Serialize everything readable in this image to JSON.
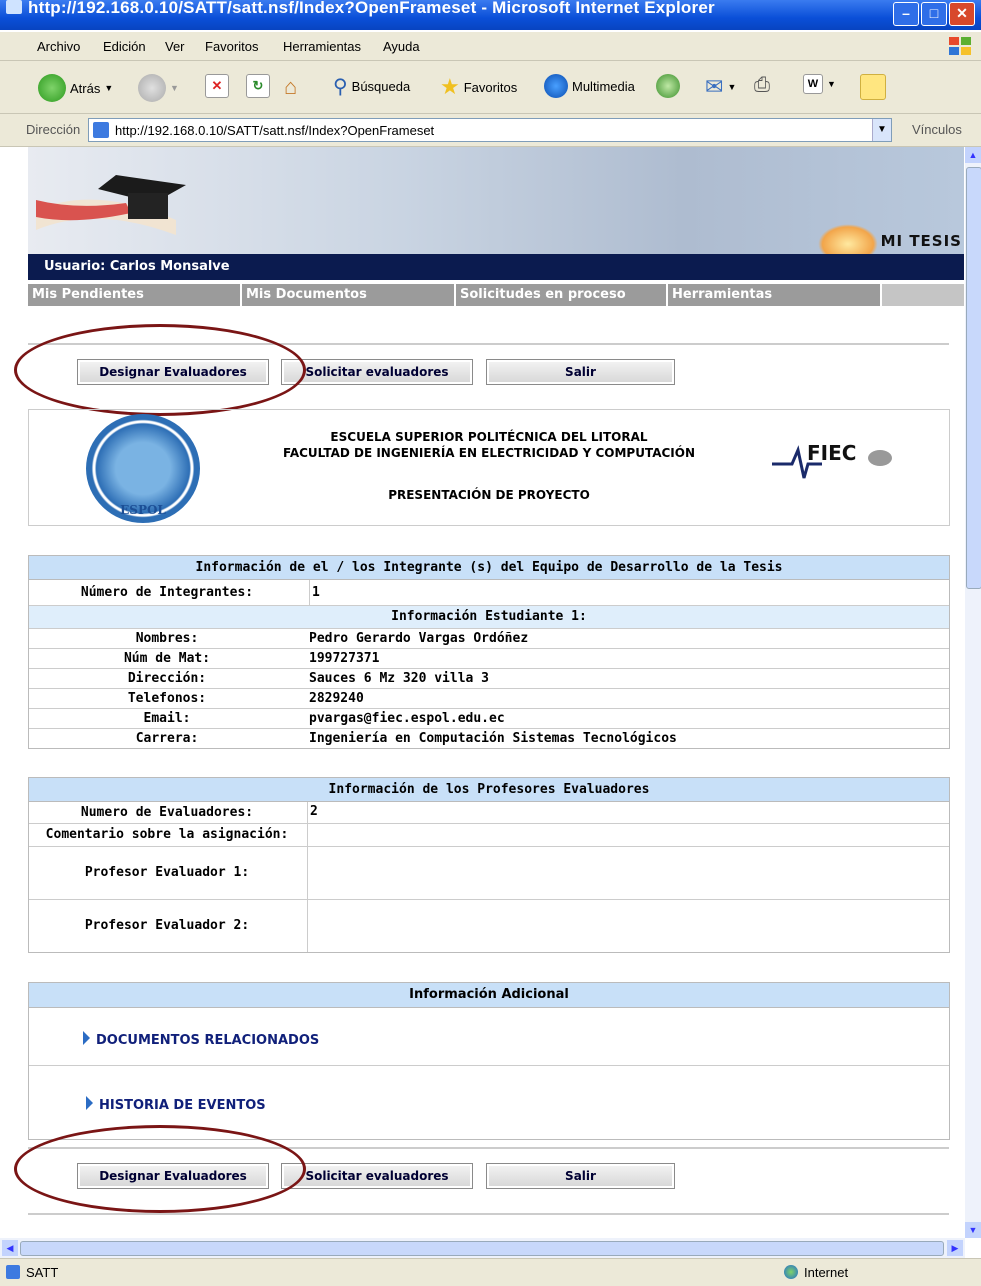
{
  "window": {
    "title": "http://192.168.0.10/SATT/satt.nsf/Index?OpenFrameset - Microsoft Internet Explorer"
  },
  "menu": [
    "Archivo",
    "Edición",
    "Ver",
    "Favoritos",
    "Herramientas",
    "Ayuda"
  ],
  "toolbar": {
    "back": "Atrás",
    "search": "Búsqueda",
    "favorites": "Favoritos",
    "media": "Multimedia"
  },
  "address": {
    "label": "Dirección",
    "url": "http://192.168.0.10/SATT/satt.nsf/Index?OpenFrameset",
    "links": "Vínculos"
  },
  "status": {
    "left": "SATT",
    "right": "Internet"
  },
  "banner": {
    "logo": "MI TESIS"
  },
  "user": {
    "label": "Usuario: Carlos Monsalve"
  },
  "nav": [
    "Mis Pendientes",
    "Mis Documentos",
    "Solicitudes en proceso",
    "Herramientas"
  ],
  "buttons": {
    "designar": "Designar Evaluadores",
    "solicitar": "Solicitar evaluadores",
    "salir": "Salir"
  },
  "header": {
    "line1": "ESCUELA SUPERIOR POLITÉCNICA DEL LITORAL",
    "line2": "FACULTAD DE INGENIERÍA EN ELECTRICIDAD Y COMPUTACIÓN",
    "line3": "PRESENTACIÓN DE PROYECTO",
    "seal_text": "ESPOL",
    "fiec": "FIEC"
  },
  "integrantes": {
    "title": "Información de el / los Integrante (s) del Equipo de Desarrollo de la Tesis",
    "count_label": "Número de Integrantes:",
    "count": "1",
    "student_title": "Información Estudiante 1:",
    "rows": [
      {
        "label": "Nombres:",
        "value": "Pedro Gerardo Vargas Ordóñez"
      },
      {
        "label": "Núm de Mat:",
        "value": "199727371"
      },
      {
        "label": "Dirección:",
        "value": "Sauces 6 Mz 320 villa 3"
      },
      {
        "label": "Telefonos:",
        "value": "2829240"
      },
      {
        "label": "Email:",
        "value": "pvargas@fiec.espol.edu.ec"
      },
      {
        "label": "Carrera:",
        "value": "Ingeniería en Computación Sistemas Tecnológicos"
      }
    ]
  },
  "evaluadores": {
    "title": "Información de los Profesores Evaluadores",
    "count_label": "Numero de Evaluadores:",
    "count": "2",
    "comment_label": "Comentario sobre la asignación:",
    "prof1_label": "Profesor Evaluador 1:",
    "prof2_label": "Profesor Evaluador 2:"
  },
  "adicional": {
    "title": "Información Adicional",
    "docs": "DOCUMENTOS RELACIONADOS",
    "history": "HISTORIA DE EVENTOS"
  }
}
